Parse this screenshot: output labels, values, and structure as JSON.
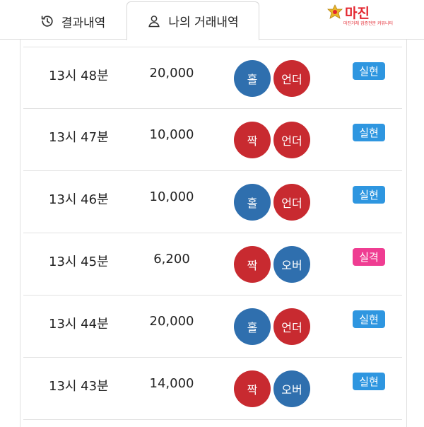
{
  "tabs": {
    "results": {
      "label": "결과내역",
      "icon": "history-icon"
    },
    "mine": {
      "label": "나의 거래내역",
      "icon": "user-icon",
      "active": true
    }
  },
  "brand": {
    "name": "마진",
    "sub": "마진거래 검증전문 커뮤니티"
  },
  "colors": {
    "blue": "#2f6fae",
    "red": "#c82a30",
    "success": "#2e96e0",
    "fail": "#ef3d92"
  },
  "rows": [
    {
      "time": "13시 48분",
      "amount": "20,000",
      "pick1": {
        "label": "홀",
        "color": "blue"
      },
      "pick2": {
        "label": "언더",
        "color": "red"
      },
      "result": {
        "label": "실현",
        "color": "success"
      }
    },
    {
      "time": "13시 47분",
      "amount": "10,000",
      "pick1": {
        "label": "짝",
        "color": "red"
      },
      "pick2": {
        "label": "언더",
        "color": "red"
      },
      "result": {
        "label": "실현",
        "color": "success"
      }
    },
    {
      "time": "13시 46분",
      "amount": "10,000",
      "pick1": {
        "label": "홀",
        "color": "blue"
      },
      "pick2": {
        "label": "언더",
        "color": "red"
      },
      "result": {
        "label": "실현",
        "color": "success"
      }
    },
    {
      "time": "13시 45분",
      "amount": "6,200",
      "pick1": {
        "label": "짝",
        "color": "red"
      },
      "pick2": {
        "label": "오버",
        "color": "blue"
      },
      "result": {
        "label": "실격",
        "color": "fail"
      }
    },
    {
      "time": "13시 44분",
      "amount": "20,000",
      "pick1": {
        "label": "홀",
        "color": "blue"
      },
      "pick2": {
        "label": "언더",
        "color": "red"
      },
      "result": {
        "label": "실현",
        "color": "success"
      }
    },
    {
      "time": "13시 43분",
      "amount": "14,000",
      "pick1": {
        "label": "짝",
        "color": "red"
      },
      "pick2": {
        "label": "오버",
        "color": "blue"
      },
      "result": {
        "label": "실현",
        "color": "success"
      }
    }
  ]
}
